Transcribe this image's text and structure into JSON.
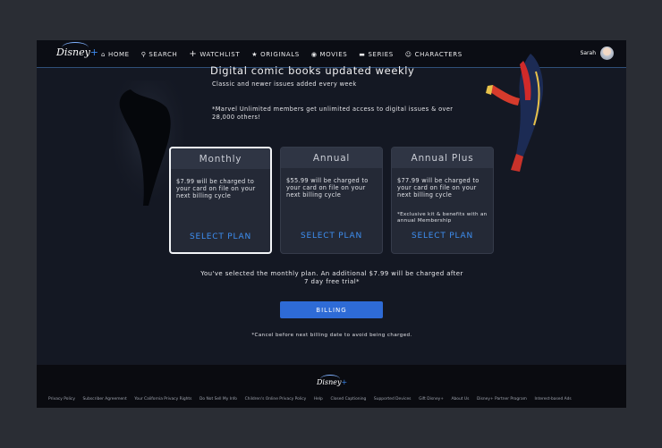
{
  "nav": {
    "logo": "Disney",
    "logo_plus": "+",
    "items": [
      {
        "label": "HOME",
        "icon": "home-icon",
        "glyph": "⌂"
      },
      {
        "label": "SEARCH",
        "icon": "search-icon",
        "glyph": "⚲"
      },
      {
        "label": "WATCHLIST",
        "icon": "plus-icon",
        "glyph": "+"
      },
      {
        "label": "ORIGINALS",
        "icon": "star-icon",
        "glyph": "★"
      },
      {
        "label": "MOVIES",
        "icon": "film-icon",
        "glyph": "◉"
      },
      {
        "label": "SERIES",
        "icon": "tv-icon",
        "glyph": "▬"
      },
      {
        "label": "CHARACTERS",
        "icon": "face-icon",
        "glyph": "☺"
      }
    ],
    "user_name": "Sarah"
  },
  "main": {
    "title": "Digital comic books updated weekly",
    "subtitle": "Classic and newer issues added every week",
    "note": "*Marvel Unlimited members get unlimited access to digital issues & over 28,000 others!",
    "plans": [
      {
        "name": "Monthly",
        "desc": "$7.99 will be charged to your card on file on your next billing cycle",
        "extra": "",
        "cta": "SELECT PLAN",
        "selected": true
      },
      {
        "name": "Annual",
        "desc": "$55.99 will be charged to your card on file on your next billing cycle",
        "extra": "",
        "cta": "SELECT PLAN",
        "selected": false
      },
      {
        "name": "Annual Plus",
        "desc": "$77.99 will be charged to your card on file on your next billing cycle",
        "extra": "*Exclusive kit & benefits with an annual Membership",
        "cta": "SELECT PLAN",
        "selected": false
      }
    ],
    "selected_message": "You've selected the monthly plan. An additional $7.99 will be charged after 7 day free trial*",
    "billing_button": "BILLING",
    "cancel_note": "*Cancel before next billing date to avoid being charged."
  },
  "footer": {
    "logo": "Disney",
    "logo_plus": "+",
    "links": [
      "Privacy Policy",
      "Subscriber Agreement",
      "Your California Privacy Rights",
      "Do Not Sell My Info",
      "Children's Online Privacy Policy",
      "Help",
      "Closed Captioning",
      "Supported Devices",
      "Gift Disney+",
      "About Us",
      "Disney+ Partner Program",
      "Interest-based Ads"
    ]
  },
  "colors": {
    "accent": "#3e8ff2",
    "button": "#2e6bd6",
    "background": "#141823"
  }
}
